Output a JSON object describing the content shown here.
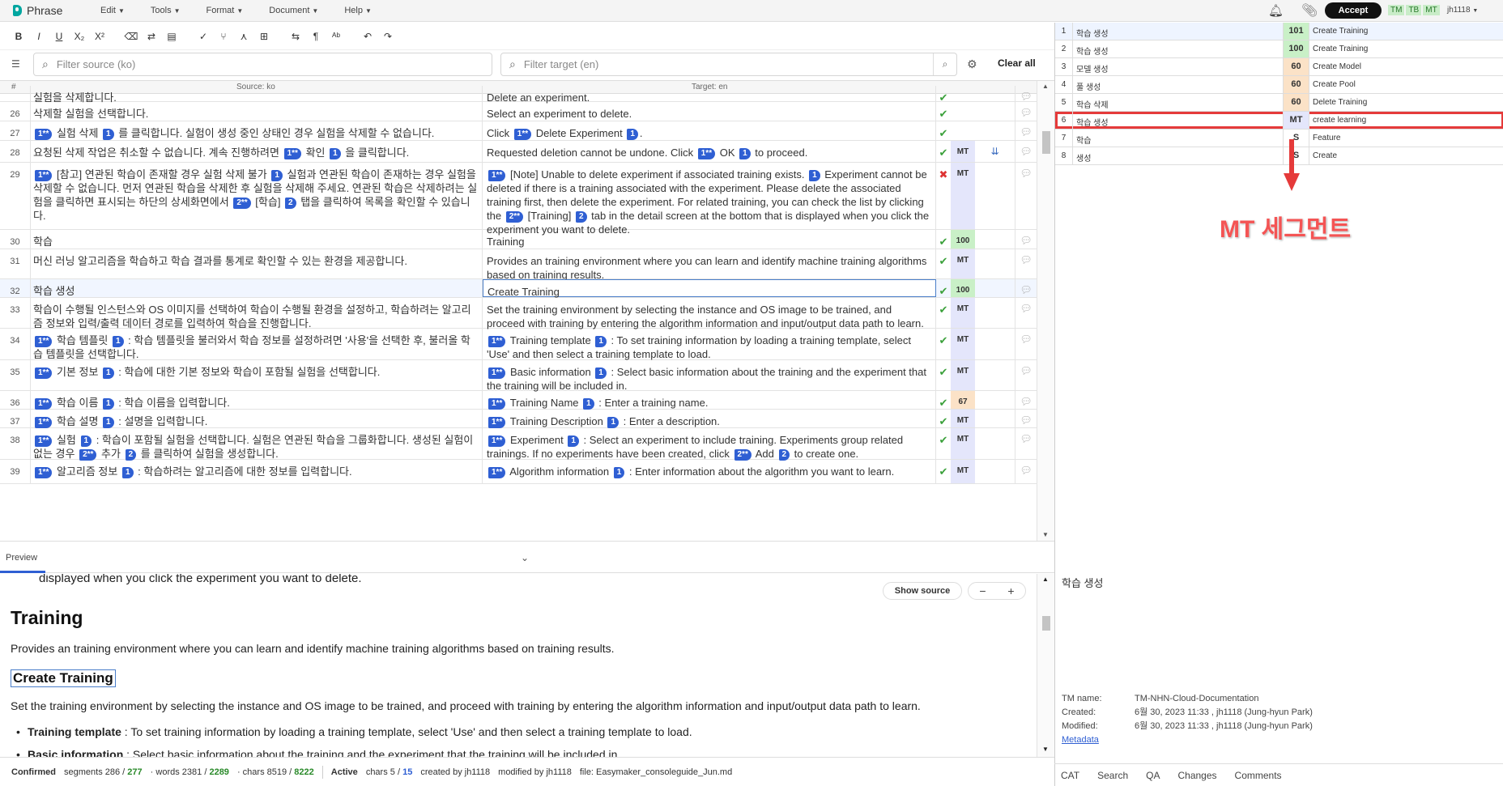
{
  "app": {
    "name": "Phrase"
  },
  "menu": [
    "Edit",
    "Tools",
    "Format",
    "Document",
    "Help"
  ],
  "header": {
    "accept_label": "Accept",
    "toggles": [
      "TM",
      "TB",
      "MT"
    ],
    "user": "jh1118"
  },
  "toolbar": {
    "buttons": [
      "bold",
      "italic",
      "underline",
      "subscript",
      "superscript",
      "clear-format",
      "copy-source",
      "insert-tags",
      "qa-check",
      "branch",
      "join",
      "split",
      "find-replace",
      "paragraph",
      "spell",
      "undo",
      "redo"
    ]
  },
  "filter": {
    "source_placeholder": "Filter source (ko)",
    "target_placeholder": "Filter target (en)",
    "clear_all": "Clear all"
  },
  "grid": {
    "header": {
      "num": "#",
      "source": "Source: ko",
      "target": "Target: en"
    },
    "rows": [
      {
        "num": "",
        "src": "실험을 삭제합니다.",
        "tgt": "Delete an experiment.",
        "status": "ok",
        "score": "",
        "scoreClass": ""
      },
      {
        "num": "26",
        "src": "삭제할 실험을 선택합니다.",
        "tgt": "Select an experiment to delete.",
        "status": "ok",
        "score": "",
        "scoreClass": ""
      },
      {
        "num": "27",
        "src": "[T1] 실험 삭제 [T1e] 를 클릭합니다. 실험이 생성 중인 상태인 경우 실험을 삭제할 수 없습니다.",
        "tgt": "Click [T1] Delete Experiment [T1e].",
        "status": "ok",
        "score": "",
        "scoreClass": ""
      },
      {
        "num": "28",
        "src": "요청된 삭제 작업은 취소할 수 없습니다. 계속 진행하려면 [T1] 확인 [T1e] 을 클릭합니다.",
        "tgt": "Requested deletion cannot be undone. Click [T1] OK [T1e] to proceed.",
        "status": "ok",
        "score": "MT",
        "scoreClass": "sc-mt",
        "extra": "⇊"
      },
      {
        "num": "29",
        "src": "[T1] [참고] 연관된 학습이 존재할 경우 실험 삭제 불가 [T1e] 실험과 연관된 학습이 존재하는 경우 실험을 삭제할 수 없습니다. 먼저 연관된 학습을 삭제한 후 실험을 삭제해 주세요. 연관된 학습은 삭제하려는 실험을 클릭하면 표시되는 하단의 상세화면에서 [T2] [학습] [T2e] 탭을 클릭하여 목록을 확인할 수 있습니다.",
        "tgt": "[T1] [Note] Unable to delete experiment if associated training exists. [T1e] Experiment cannot be deleted if there is a training associated with the experiment. Please delete the associated training first, then delete the experiment. For related training, you can check the list by clicking the [T2] [Training] [T2e] tab in the detail screen at the bottom that is displayed when you click the experiment you want to delete.",
        "status": "err",
        "score": "MT",
        "scoreClass": "sc-mt"
      },
      {
        "num": "30",
        "src": "학습",
        "tgt": "Training",
        "status": "ok",
        "score": "100",
        "scoreClass": "sc-100"
      },
      {
        "num": "31",
        "src": "머신 러닝 알고리즘을 학습하고 학습 결과를 통계로 확인할 수 있는 환경을 제공합니다.",
        "tgt": "Provides an training environment where you can learn and identify machine training algorithms based on training results.",
        "status": "ok",
        "score": "MT",
        "scoreClass": "sc-mt"
      },
      {
        "num": "32",
        "src": "학습 생성",
        "tgt": "Create Training",
        "status": "ok",
        "score": "100",
        "scoreClass": "sc-100",
        "active": true
      },
      {
        "num": "33",
        "src": "학습이 수행될 인스턴스와 OS 이미지를 선택하여 학습이 수행될 환경을 설정하고, 학습하려는 알고리즘 정보와 입력/출력 데이터 경로를 입력하여 학습을 진행합니다.",
        "tgt": "Set the training environment by selecting the instance and OS image to be trained, and proceed with training by entering the algorithm information and input/output data path to learn.",
        "status": "ok",
        "score": "MT",
        "scoreClass": "sc-mt"
      },
      {
        "num": "34",
        "src": "[T1] 학습 템플릿 [T1e] : 학습 템플릿을 불러와서 학습 정보를 설정하려면 '사용'을 선택한 후, 불러올 학습 템플릿을 선택합니다.",
        "tgt": "[T1] Training template [T1e] : To set training information by loading a training template, select 'Use' and then select a training template to load.",
        "status": "ok",
        "score": "MT",
        "scoreClass": "sc-mt"
      },
      {
        "num": "35",
        "src": "[T1] 기본 정보 [T1e] : 학습에 대한 기본 정보와 학습이 포함될 실험을 선택합니다.",
        "tgt": "[T1] Basic information [T1e] : Select basic information about the training and the experiment that the training will be included in.",
        "status": "ok",
        "score": "MT",
        "scoreClass": "sc-mt"
      },
      {
        "num": "36",
        "src": "[T1] 학습 이름 [T1e] : 학습 이름을 입력합니다.",
        "tgt": "[T1] Training Name [T1e] : Enter a training name.",
        "status": "ok",
        "score": "67",
        "scoreClass": "sc-67"
      },
      {
        "num": "37",
        "src": "[T1] 학습 설명 [T1e] : 설명을 입력합니다.",
        "tgt": "[T1] Training Description [T1e] : Enter a description.",
        "status": "ok",
        "score": "MT",
        "scoreClass": "sc-mt"
      },
      {
        "num": "38",
        "src": "[T1] 실험 [T1e] : 학습이 포함될 실험을 선택합니다. 실험은 연관된 학습을 그룹화합니다. 생성된 실험이 없는 경우 [T2] 추가 [T2e] 를 클릭하여 실험을 생성합니다.",
        "tgt": "[T1] Experiment [T1e] : Select an experiment to include training. Experiments group related trainings. If no experiments have been created, click [T2] Add [T2e] to create one.",
        "status": "ok",
        "score": "MT",
        "scoreClass": "sc-mt"
      },
      {
        "num": "39",
        "src": "[T1] 알고리즘 정보 [T1e] : 학습하려는 알고리즘에 대한 정보를 입력합니다.",
        "tgt": "[T1] Algorithm information [T1e] : Enter information about the algorithm you want to learn.",
        "status": "ok",
        "score": "MT",
        "scoreClass": "sc-mt"
      }
    ]
  },
  "preview": {
    "tab_label": "Preview",
    "show_source": "Show source",
    "zoom_out": "−",
    "zoom_in": "+",
    "cut_line": "displayed when you click the experiment you want to delete.",
    "heading": "Training",
    "para1": "Provides an training environment where you can learn and identify machine training algorithms based on training results.",
    "subheading": "Create Training",
    "para2": "Set the training environment by selecting the instance and OS image to be trained, and proceed with training by entering the algorithm information and input/output data path to learn.",
    "bullets": [
      {
        "term": "Training template",
        "text": " : To set training information by loading a training template, select 'Use' and then select a training template to load."
      },
      {
        "term": "Basic information",
        "text": " : Select basic information about the training and the experiment that the training will be included in."
      }
    ]
  },
  "status": {
    "confirmed_label": "Confirmed",
    "segments_label": "segments",
    "segments_a": "286",
    "segments_b": "277",
    "words_label": "words",
    "words_a": "2381",
    "words_b": "2289",
    "chars_label": "chars",
    "chars_a": "8519",
    "chars_b": "8222",
    "active_label": "Active",
    "active_chars_label": "chars",
    "active_chars_a": "5",
    "active_chars_b": "15",
    "created_by": "created by  jh1118",
    "modified_by": "modified by  jh1118",
    "file": "file:  Easymaker_consoleguide_Jun.md"
  },
  "tm_matches": [
    {
      "n": "1",
      "src": "학습 생성",
      "score": "101",
      "cls": "sc-100",
      "tgt": "Create Training",
      "sel": true
    },
    {
      "n": "2",
      "src": "학습 생성",
      "score": "100",
      "cls": "sc-100",
      "tgt": "Create Training"
    },
    {
      "n": "3",
      "src": "모델 생성",
      "score": "60",
      "cls": "sc-67",
      "tgt": "Create Model"
    },
    {
      "n": "4",
      "src": "풀 생성",
      "score": "60",
      "cls": "sc-67",
      "tgt": "Create Pool"
    },
    {
      "n": "5",
      "src": "학습 삭제",
      "score": "60",
      "cls": "sc-67",
      "tgt": "Delete Training"
    },
    {
      "n": "6",
      "src": "학습 생성",
      "score": "MT",
      "cls": "sc-mt",
      "tgt": "create learning",
      "hl": true
    },
    {
      "n": "7",
      "src": "학습",
      "score": "S",
      "cls": "",
      "tgt": "Feature"
    },
    {
      "n": "8",
      "src": "생성",
      "score": "S",
      "cls": "",
      "tgt": "Create"
    }
  ],
  "annotation": {
    "label": "MT 세그먼트",
    "color": "#f45454"
  },
  "tm_detail": {
    "source": "학습 생성",
    "tm_name_label": "TM name:",
    "tm_name": "TM-NHN-Cloud-Documentation",
    "created_label": "Created:",
    "created": "6월 30, 2023 11:33 , jh1118 (Jung-hyun Park)",
    "modified_label": "Modified:",
    "modified": "6월 30, 2023 11:33 , jh1118 (Jung-hyun Park)",
    "metadata": "Metadata"
  },
  "bottom_tabs": [
    "CAT",
    "Search",
    "QA",
    "Changes",
    "Comments"
  ]
}
